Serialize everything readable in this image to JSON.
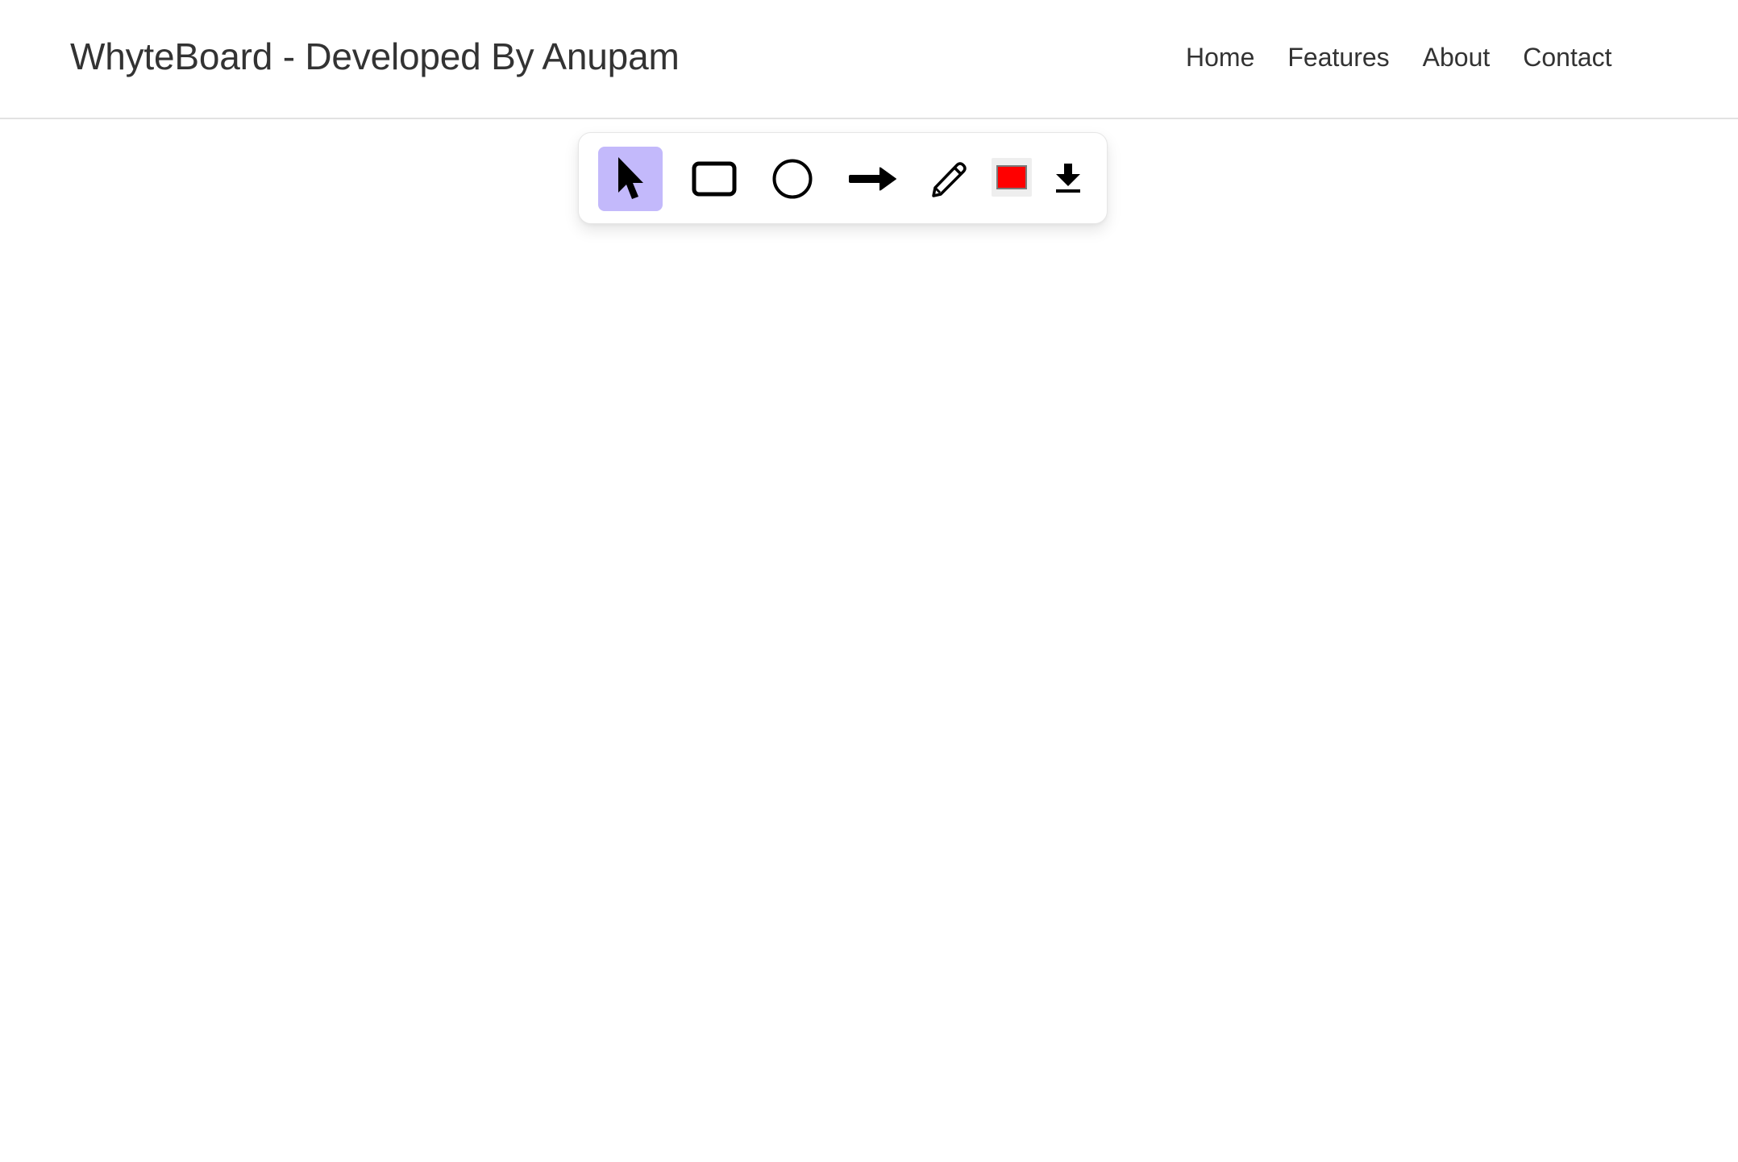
{
  "header": {
    "brand": "WhyteBoard - Developed By Anupam",
    "nav": [
      {
        "label": "Home"
      },
      {
        "label": "Features"
      },
      {
        "label": "About"
      },
      {
        "label": "Contact"
      }
    ]
  },
  "toolbar": {
    "tools": [
      {
        "id": "select",
        "icon": "cursor-arrow-icon",
        "selected": true
      },
      {
        "id": "rectangle",
        "icon": "rectangle-icon",
        "selected": false
      },
      {
        "id": "circle",
        "icon": "circle-icon",
        "selected": false
      },
      {
        "id": "arrow",
        "icon": "arrow-right-icon",
        "selected": false
      },
      {
        "id": "pencil",
        "icon": "pencil-icon",
        "selected": false
      },
      {
        "id": "color",
        "icon": "color-swatch",
        "selected": false
      },
      {
        "id": "download",
        "icon": "download-icon",
        "selected": false
      }
    ],
    "current_color": "#ff0000",
    "selected_bg": "#c3b9fb"
  }
}
